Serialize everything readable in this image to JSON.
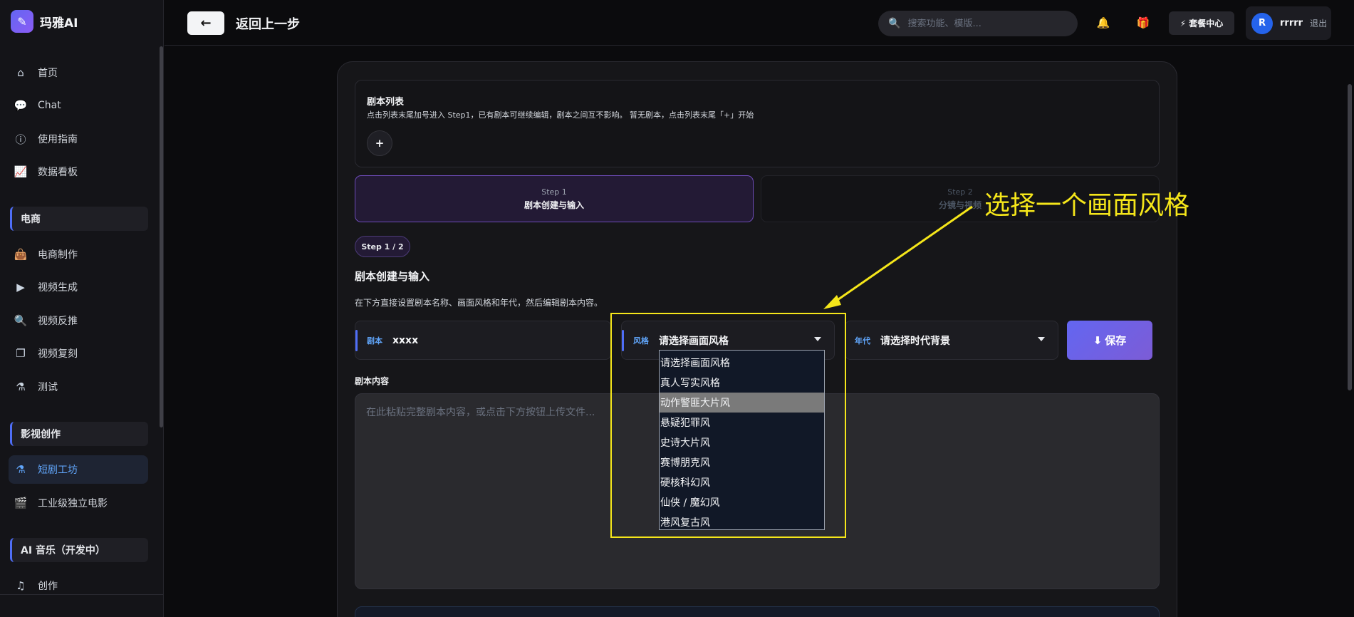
{
  "sidebar": {
    "brand": "玛雅AI",
    "items_top": [
      {
        "label": "首页",
        "icon": "home-icon"
      },
      {
        "label": "Chat",
        "icon": "chat-icon"
      },
      {
        "label": "使用指南",
        "icon": "help-icon"
      },
      {
        "label": "数据看板",
        "icon": "chart-icon"
      }
    ],
    "section_ecommerce": "电商",
    "items_ecommerce": [
      {
        "label": "电商制作",
        "icon": "bag-icon"
      },
      {
        "label": "视频生成",
        "icon": "video-icon"
      },
      {
        "label": "视频反推",
        "icon": "search-video-icon"
      },
      {
        "label": "视频复刻",
        "icon": "copy-icon"
      },
      {
        "label": "测试",
        "icon": "flask-icon"
      }
    ],
    "section_film": "影视创作",
    "items_film": [
      {
        "label": "短剧工坊",
        "icon": "flask-icon",
        "active": true
      },
      {
        "label": "工业级独立电影",
        "icon": "clapper-icon"
      }
    ],
    "section_music": "AI 音乐（开发中）",
    "items_music": [
      {
        "label": "创作",
        "icon": "music-icon"
      }
    ]
  },
  "topbar": {
    "back_label": "返回上一步",
    "search_placeholder": "搜索功能、模版...",
    "plan_label": "套餐中心",
    "avatar_letter": "R",
    "username": "rrrrr",
    "logout": "退出"
  },
  "script_list": {
    "title": "剧本列表",
    "description": "点击列表末尾加号进入 Step1，已有剧本可继续编辑，剧本之间互不影响。  暂无剧本，点击列表末尾「+」开始",
    "add_label": "+"
  },
  "steps": [
    {
      "number": "Step 1",
      "title": "剧本创建与输入"
    },
    {
      "number": "Step 2",
      "title": "分镜与视频"
    }
  ],
  "step_pill": "Step 1 / 2",
  "heading": "剧本创建与输入",
  "heading_desc": "在下方直接设置剧本名称、画面风格和年代，然后编辑剧本内容。",
  "fields": {
    "script_label": "剧本",
    "script_value": "xxxx",
    "style_label": "风格",
    "style_value": "请选择画面风格",
    "era_label": "年代",
    "era_value": "请选择时代背景"
  },
  "save_label": "保存",
  "content_label": "剧本内容",
  "content_placeholder": "在此粘贴完整剧本内容，或点击下方按钮上传文件...",
  "style_options": [
    "请选择画面风格",
    "真人写实风格",
    "动作警匪大片风",
    "悬疑犯罪风",
    "史诗大片风",
    "赛博朋克风",
    "硬核科幻风",
    "仙侠 / 魔幻风",
    "港风复古风"
  ],
  "highlighted_option_index": 2,
  "annotation": {
    "text": "选择一个画面风格",
    "color": "#f5e61a"
  }
}
